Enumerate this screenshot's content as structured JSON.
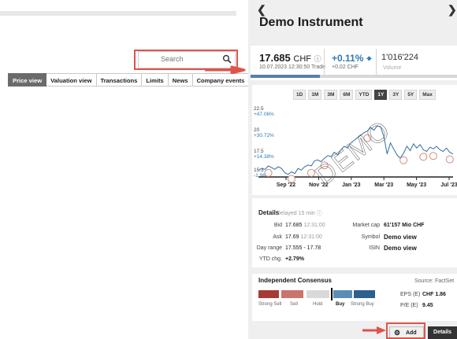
{
  "search": {
    "placeholder": "Search"
  },
  "tabs": [
    {
      "label": "Price view",
      "active": true
    },
    {
      "label": "Valuation view"
    },
    {
      "label": "Transactions"
    },
    {
      "label": "Limits"
    },
    {
      "label": "News"
    },
    {
      "label": "Company events"
    }
  ],
  "panel": {
    "title": "Demo Instrument",
    "price": "17.685",
    "currency": "CHF",
    "timestamp": "10.07.2023 12:30:50 Trade",
    "change_pct": "+0.11%",
    "change_abs": "+0.02 CHF",
    "volume": "1'016'224",
    "volume_label": "Volume",
    "ranges": [
      "1D",
      "1M",
      "3M",
      "6M",
      "YTD",
      "1Y",
      "3Y",
      "5Y",
      "Max"
    ],
    "active_range": "1Y",
    "watermark": "DEMO",
    "details": {
      "title": "Details",
      "delayed": "Delayed 15 min",
      "bid_label": "Bid",
      "bid_value": "17.685",
      "bid_time": "12:31:00",
      "ask_label": "Ask",
      "ask_value": "17.69",
      "ask_time": "12:31:00",
      "dayrange_label": "Day range",
      "dayrange_value": "17.555 - 17.78",
      "ytd_label": "YTD chg.",
      "ytd_value": "+2.79%",
      "mcap_label": "Market cap",
      "mcap_value": "61'157 Mio CHF",
      "symbol_label": "Symbol",
      "symbol_value": "Demo view",
      "isin_label": "ISIN",
      "isin_value": "Demo view"
    },
    "consensus": {
      "title": "Independent Consensus",
      "source": "Source: FactSet",
      "labels": [
        "Strong Sell",
        "Sell",
        "Hold",
        "Buy",
        "Strong Buy"
      ],
      "eps_label": "EPS (E)",
      "eps_value": "CHF 1.86",
      "pe_label": "P/E (E)",
      "pe_value": "9.45",
      "colors": {
        "strong_sell": "#a83a34",
        "sell": "#c9746d",
        "hold": "#d9d9d9",
        "buy": "#5b8db6",
        "strong_buy": "#2d5f8f"
      }
    },
    "add_label": "Add",
    "details_label": "Details"
  },
  "chart_data": {
    "type": "line",
    "x_tick_labels": [
      "Sep '22",
      "Nov '22",
      "Jan '23",
      "Mar '23",
      "May '23",
      "Jul '23"
    ],
    "y_tick_labels": [
      {
        "price": "22.5",
        "pct": "+47.06%"
      },
      {
        "price": "20",
        "pct": "+30.72%"
      },
      {
        "price": "17.5",
        "pct": "+14.38%"
      },
      {
        "price": "15.3",
        "pct": "-1.96%"
      }
    ],
    "ylim": [
      15.0,
      23.5
    ],
    "series": [
      {
        "values": [
          15.8,
          16.0,
          15.9,
          16.3,
          16.1,
          15.9,
          16.2,
          16.0,
          15.5,
          15.3,
          15.6,
          15.4,
          16.0,
          15.8,
          16.2,
          16.4,
          16.3,
          16.9,
          17.0,
          16.8,
          17.2,
          17.5,
          17.4,
          17.9,
          17.6,
          18.2,
          18.6,
          18.4,
          19.0,
          19.3,
          19.6,
          19.9,
          20.2,
          20.4,
          20.8,
          20.5,
          21.0,
          20.9,
          19.8,
          17.7,
          19.0,
          18.3,
          17.6,
          17.2,
          17.8,
          18.6,
          18.1,
          18.9,
          18.4,
          18.8,
          18.2,
          18.0,
          18.5,
          18.3,
          18.6,
          18.2,
          18.0,
          18.4,
          17.9,
          17.7
        ]
      }
    ]
  }
}
